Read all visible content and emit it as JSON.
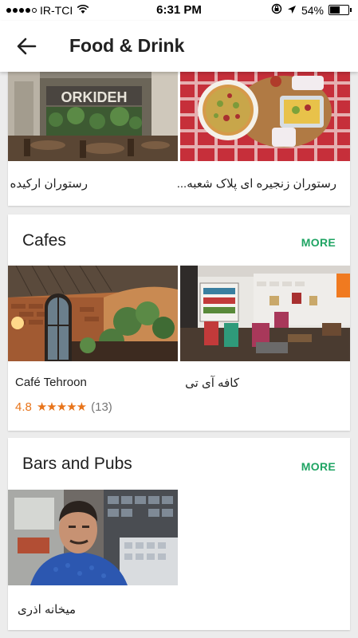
{
  "status_bar": {
    "carrier": "IR-TCI",
    "time": "6:31 PM",
    "battery": "54%",
    "battery_level": 0.54
  },
  "header": {
    "title": "Food & Drink"
  },
  "restaurants": {
    "items": [
      {
        "name": "رستوران ارکیده",
        "photo_icon": "restaurant-photo"
      },
      {
        "name": "رستوران زنجیره ای پلاک شعبه...",
        "photo_icon": "pizza-photo"
      }
    ]
  },
  "cafes": {
    "title": "Cafes",
    "more_label": "MORE",
    "items": [
      {
        "name": "Café Tehroon",
        "rating": "4.8",
        "stars": "★★★★★",
        "reviews": "(13)"
      },
      {
        "name": "کافه آی تی"
      }
    ]
  },
  "bars": {
    "title": "Bars and Pubs",
    "more_label": "MORE",
    "items": [
      {
        "name": "میخانه اذری"
      }
    ]
  },
  "colors": {
    "accent": "#1fa463",
    "rating": "#e8741a",
    "background": "#ececec"
  }
}
